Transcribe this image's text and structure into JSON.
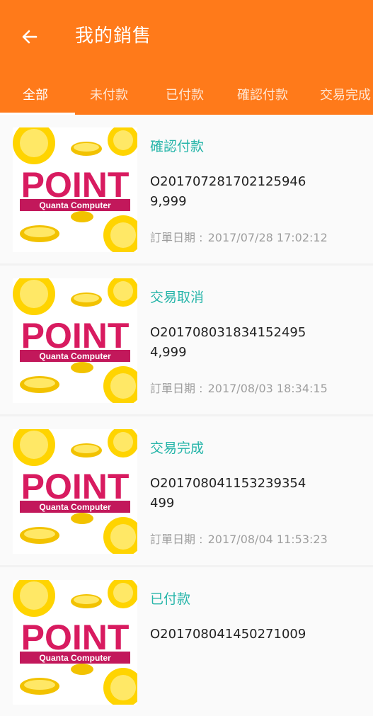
{
  "header": {
    "title": "我的銷售",
    "back_icon": "arrow-left-icon",
    "background": "#ff7a1a"
  },
  "tabs": [
    {
      "label": "全部",
      "active": true
    },
    {
      "label": "未付款",
      "active": false
    },
    {
      "label": "已付款",
      "active": false
    },
    {
      "label": "確認付款",
      "active": false
    },
    {
      "label": "交易完成",
      "active": false
    }
  ],
  "accent_status_color": "#26b5a9",
  "date_label": "訂單日期 :",
  "product_image": {
    "brand": "POINT",
    "subtitle": "Quanta Computer",
    "brand_color": "#d81b60"
  },
  "orders": [
    {
      "status": "確認付款",
      "order_no": "O201707281702125946",
      "amount": "9,999",
      "date": "2017/07/28 17:02:12"
    },
    {
      "status": "交易取消",
      "order_no": "O201708031834152495",
      "amount": "4,999",
      "date": "2017/08/03 18:34:15"
    },
    {
      "status": "交易完成",
      "order_no": "O201708041153239354",
      "amount": "499",
      "date": "2017/08/04 11:53:23"
    },
    {
      "status": "已付款",
      "order_no": "O201708041450271009",
      "amount": "",
      "date": ""
    }
  ]
}
